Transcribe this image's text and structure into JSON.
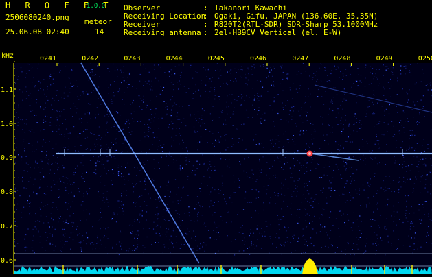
{
  "header": {
    "title": "H R O F F T",
    "version": "1.0.0",
    "filename": "2506080240.png",
    "datetime": "25.06.08 02:40",
    "counter_label": "meteor",
    "counter_value": "14"
  },
  "info": [
    {
      "label": "Observer",
      "value": "Takanori Kawachi"
    },
    {
      "label": "Receiving Location",
      "value": "Ogaki, Gifu, JAPAN (136.60E, 35.35N)"
    },
    {
      "label": "Receiver",
      "value": "R820T2(RTL-SDR) SDR-Sharp 53.1000MHz"
    },
    {
      "label": "Receiving antenna",
      "value": "2el-HB9CV Vertical (el. E-W)"
    }
  ],
  "axes": {
    "y_unit": "kHz",
    "y_ticks": [
      "1.1",
      "1.0",
      "0.9",
      "0.8",
      "0.7",
      "0.6"
    ],
    "x_ticks": [
      "0241",
      "0242",
      "0243",
      "0244",
      "0245",
      "0246",
      "0247",
      "0248",
      "0249",
      "0250"
    ]
  },
  "colors": {
    "background": "#00001a",
    "noise": "#1a2a9a",
    "carrier": "#6fa8ff",
    "meteor": "#ff4040",
    "spectrum": "#00e5ff",
    "spectrum_peak": "#ffee00",
    "axis_text": "#ffff00"
  }
}
